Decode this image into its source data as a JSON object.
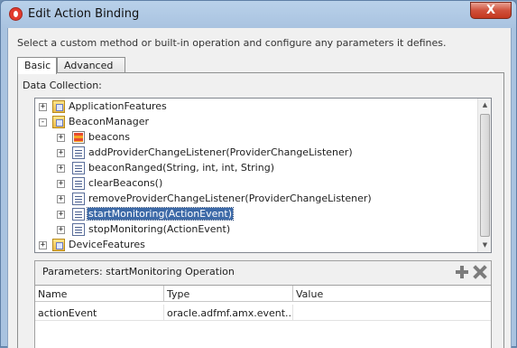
{
  "window": {
    "title": "Edit Action Binding",
    "close_glyph": "X"
  },
  "instructions": "Select a custom method or built-in operation and configure any parameters it defines.",
  "tabs": [
    {
      "label": "Basic",
      "active": true
    },
    {
      "label": "Advanced",
      "active": false
    }
  ],
  "data_collection": {
    "label": "Data Collection:",
    "tree": [
      {
        "label": "ApplicationFeatures",
        "icon": "folder-icon",
        "expander": "+"
      },
      {
        "label": "BeaconManager",
        "icon": "folder-icon",
        "expander": "-"
      },
      {
        "label": "beacons",
        "icon": "collection-icon",
        "expander": "+"
      },
      {
        "label": "addProviderChangeListener(ProviderChangeListener)",
        "icon": "method-icon",
        "expander": "+"
      },
      {
        "label": "beaconRanged(String, int, int, String)",
        "icon": "method-icon",
        "expander": "+"
      },
      {
        "label": "clearBeacons()",
        "icon": "method-icon",
        "expander": "+"
      },
      {
        "label": "removeProviderChangeListener(ProviderChangeListener)",
        "icon": "method-icon",
        "expander": "+"
      },
      {
        "label": "startMonitoring(ActionEvent)",
        "icon": "method-icon",
        "expander": "+",
        "selected": true
      },
      {
        "label": "stopMonitoring(ActionEvent)",
        "icon": "method-icon",
        "expander": "+"
      },
      {
        "label": "DeviceFeatures",
        "icon": "folder-icon",
        "expander": "+"
      }
    ]
  },
  "parameters": {
    "title": "Parameters:  startMonitoring Operation",
    "columns": [
      "Name",
      "Type",
      "Value"
    ],
    "rows": [
      [
        "actionEvent",
        "oracle.adfmf.amx.event....",
        ""
      ]
    ]
  },
  "colors": {
    "selection": "#3d6aa8",
    "titlebar": "#b9d1ea",
    "close_button": "#c4371f"
  }
}
